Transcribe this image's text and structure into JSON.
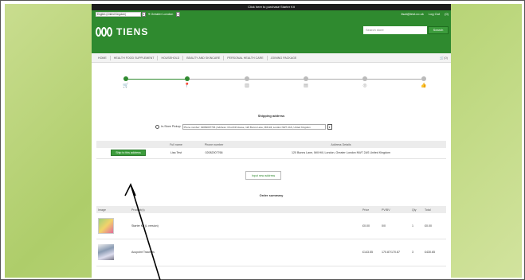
{
  "promo_text": "Click here to purchase Starter Kit",
  "header": {
    "language": "English (United Kingdom)",
    "region": "Greater London",
    "account_links": [
      "lisat@test.co.uk",
      "Log Out",
      "(0)"
    ],
    "logo_text": "TIENS",
    "search_placeholder": "Search store",
    "search_button": "Search"
  },
  "nav": {
    "items": [
      "HOME",
      "HEALTH FOOD SUPPLEMENT",
      "HOUSEHOLD",
      "BEAUTY AND SKINCARE",
      "PERSONAL HEALTH CARE",
      "JOINING PACKAGE"
    ],
    "cart": "(0)"
  },
  "steps": {
    "count": 6,
    "completed": 2,
    "icons": [
      "cart-icon",
      "location-pin-icon",
      "chart-icon",
      "card-icon",
      "target-icon",
      "thumbs-up-icon"
    ],
    "glyphs": [
      "🛒",
      "📍",
      "▥",
      "▤",
      "◎",
      "👍"
    ]
  },
  "shipping": {
    "title": "Shipping address",
    "pickup_label": "In-Store Pickup",
    "pickup_value": "Phone number: 02082007766 | Address: Churchill House, 120 Bunns Lane, Mill Hill, London NW7 2AS, United Kingdom",
    "table_headers": [
      "",
      "Full name",
      "Phone number",
      "Address Details"
    ],
    "row": {
      "button": "Ship to this address",
      "name": "Lisa Test",
      "phone": "02082007766",
      "address": "120 Bunns Lane, Mill Hill, London, Greater London NW7 2AS United Kingdom"
    },
    "new_address_button": "Input new address"
  },
  "order": {
    "title": "Order summary",
    "headers": [
      "Image",
      "Product(s)",
      "Price",
      "PV/BV",
      "Qty",
      "Total"
    ],
    "rows": [
      {
        "product": "Starter Kit (L version)",
        "price": "£0.00",
        "pvbv": "0/0",
        "qty": "1",
        "total": "£0.00"
      },
      {
        "product": "Acupoint Traumas",
        "price": "£143.55",
        "pvbv": "170.87/170.87",
        "qty": "3",
        "total": "£430.65"
      }
    ]
  },
  "colors": {
    "brand_green": "#2f8a2f",
    "background_green": "#b7d477"
  }
}
